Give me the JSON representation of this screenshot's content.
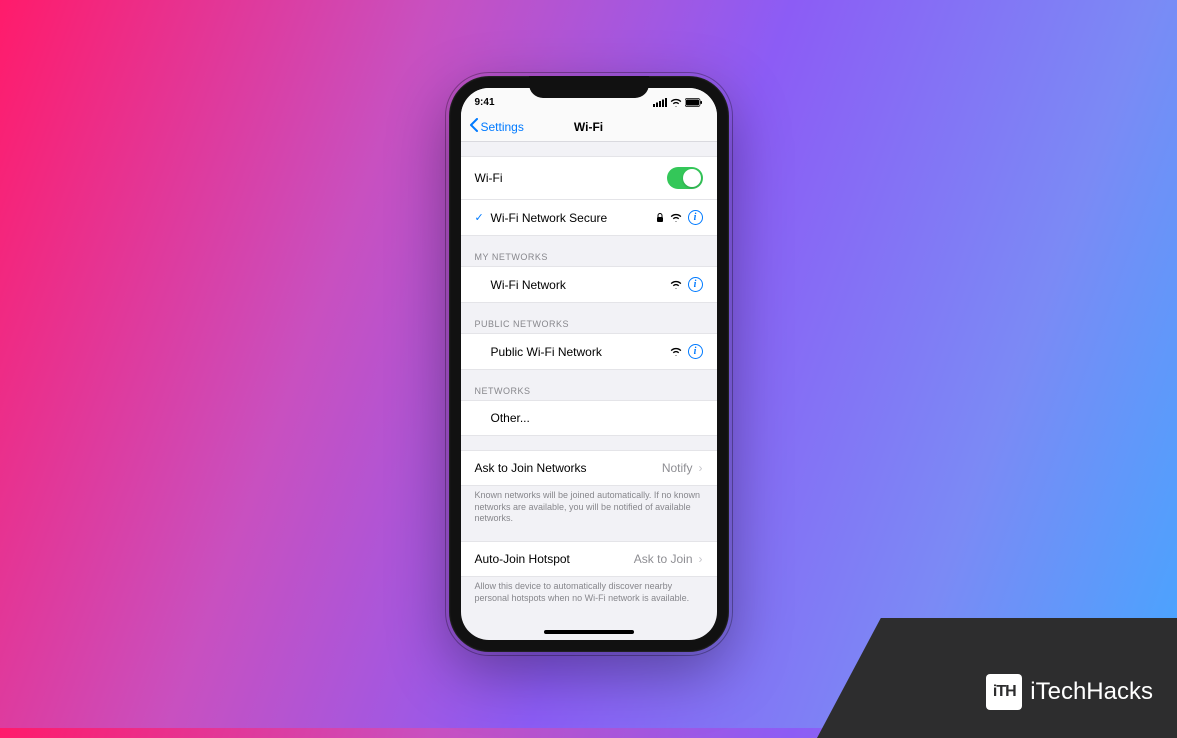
{
  "statusbar": {
    "time": "9:41"
  },
  "nav": {
    "back_label": "Settings",
    "title": "Wi-Fi"
  },
  "wifi_toggle": {
    "label": "Wi-Fi",
    "on": true
  },
  "connected": {
    "name": "Wi-Fi Network Secure",
    "secure": true
  },
  "sections": {
    "my": {
      "header": "MY NETWORKS",
      "items": [
        {
          "name": "Wi-Fi Network",
          "secure": false
        }
      ]
    },
    "public": {
      "header": "PUBLIC NETWORKS",
      "items": [
        {
          "name": "Public Wi-Fi Network",
          "secure": false
        }
      ]
    },
    "networks": {
      "header": "NETWORKS",
      "other_label": "Other..."
    }
  },
  "ask": {
    "label": "Ask to Join Networks",
    "value": "Notify",
    "footer": "Known networks will be joined automatically. If no known networks are available, you will be notified of available networks."
  },
  "hotspot": {
    "label": "Auto-Join Hotspot",
    "value": "Ask to Join",
    "footer": "Allow this device to automatically discover nearby personal hotspots when no Wi-Fi network is available."
  },
  "watermark": {
    "logo": "iTH",
    "text": "iTechHacks"
  },
  "colors": {
    "link": "#007aff",
    "toggle_on": "#34c759"
  }
}
